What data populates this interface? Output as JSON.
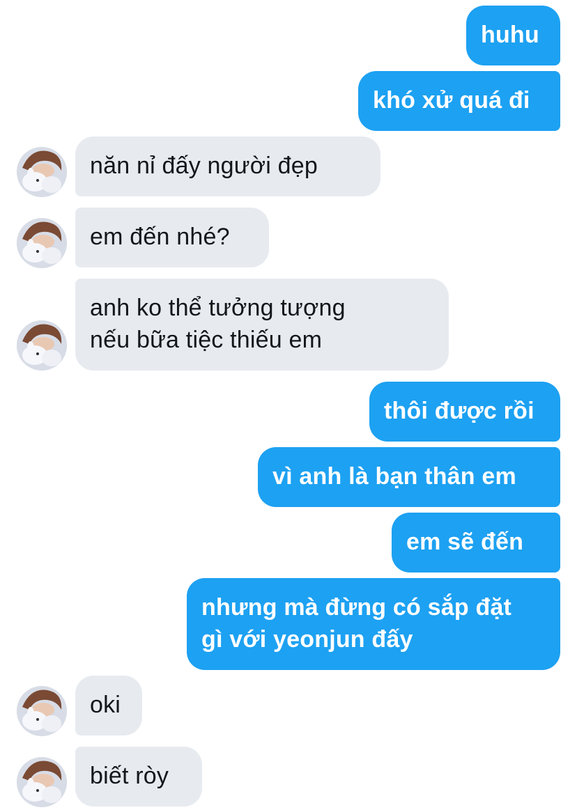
{
  "messages": [
    {
      "from": "me",
      "lines": [
        "huhu"
      ]
    },
    {
      "from": "me",
      "lines": [
        "khó xử quá đi"
      ]
    },
    {
      "from": "them",
      "lines": [
        "năn nỉ đấy người đẹp"
      ]
    },
    {
      "from": "them",
      "lines": [
        "em đến nhé?"
      ]
    },
    {
      "from": "them",
      "lines": [
        "anh ko thể tưởng tượng",
        "nếu bữa tiệc thiếu em"
      ]
    },
    {
      "from": "me",
      "lines": [
        "thôi được rồi"
      ]
    },
    {
      "from": "me",
      "lines": [
        "vì anh là bạn thân em"
      ]
    },
    {
      "from": "me",
      "lines": [
        "em sẽ đến"
      ]
    },
    {
      "from": "me",
      "lines": [
        "nhưng mà đừng có sắp đặt",
        "gì với yeonjun đấy"
      ]
    },
    {
      "from": "them",
      "lines": [
        "oki"
      ]
    },
    {
      "from": "them",
      "lines": [
        "biết ròy"
      ]
    }
  ],
  "colors": {
    "outgoing_bubble": "#1da1f2",
    "incoming_bubble": "#e7ebf0",
    "outgoing_text": "#ffffff",
    "incoming_text": "#14171a"
  }
}
